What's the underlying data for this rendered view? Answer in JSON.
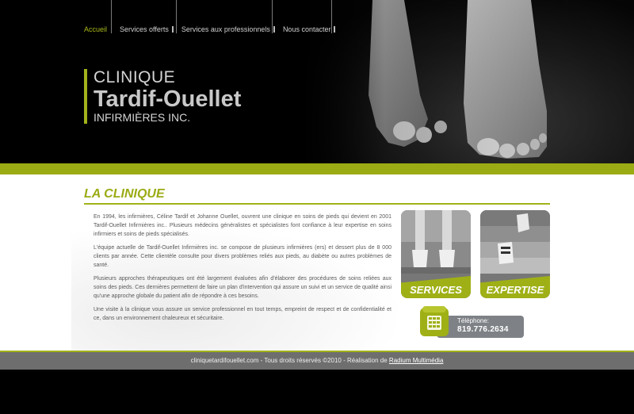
{
  "nav": {
    "items": [
      {
        "label": "Accueil"
      },
      {
        "label": "Services offerts"
      },
      {
        "label": "Services aux professionnels"
      },
      {
        "label": "Nous contacter"
      }
    ]
  },
  "logo": {
    "line1": "CLINIQUE",
    "line2": "Tardif-Ouellet",
    "line3": "INFIRMIÈRES INC."
  },
  "main": {
    "title": "LA CLINIQUE",
    "paragraphs": [
      "En 1994, les infirmières, Céline Tardif et Johanne Ouellet, ouvrent une clinique en soins de pieds qui devient en 2001 Tardif-Ouellet Infirmières inc.. Plusieurs médecins généralistes et spécialistes font confiance à leur expertise en soins infirmiers et soins de pieds spécialisés.",
      "L'équipe actuelle de Tardif-Ouellet Infirmières inc. se compose de plusieurs infirmières (ers) et dessert plus de 8 000 clients par année. Cette clientèle consulte pour divers problèmes reliés aux pieds, au diabète ou autres problèmes de santé.",
      "Plusieurs approches thérapeutiques ont été largement évaluées afin d'élaborer des procédures de soins reliées aux soins des pieds. Ces dernières permettent de faire un plan d'intervention qui assure un suivi et un service de qualité ainsi qu'une approche globale du patient afin de répondre à ces besoins.",
      "Une visite à la clinique vous assure un service professionnel en tout temps, empreint de respect et de confidentialité et ce, dans un environnement chaleureux et sécuritaire."
    ]
  },
  "cards": {
    "services": "SERVICES",
    "expertise": "EXPERTISE"
  },
  "phone": {
    "label": "Téléphone:",
    "number": "819.776.2634"
  },
  "footer": {
    "text": "cliniquetardifouellet.com - Tous droits réservés ©2010 - Réalisation de ",
    "link": "Radium Multimédia"
  },
  "colors": {
    "accent": "#9bab13",
    "footer_bg": "#6e6e6e"
  }
}
